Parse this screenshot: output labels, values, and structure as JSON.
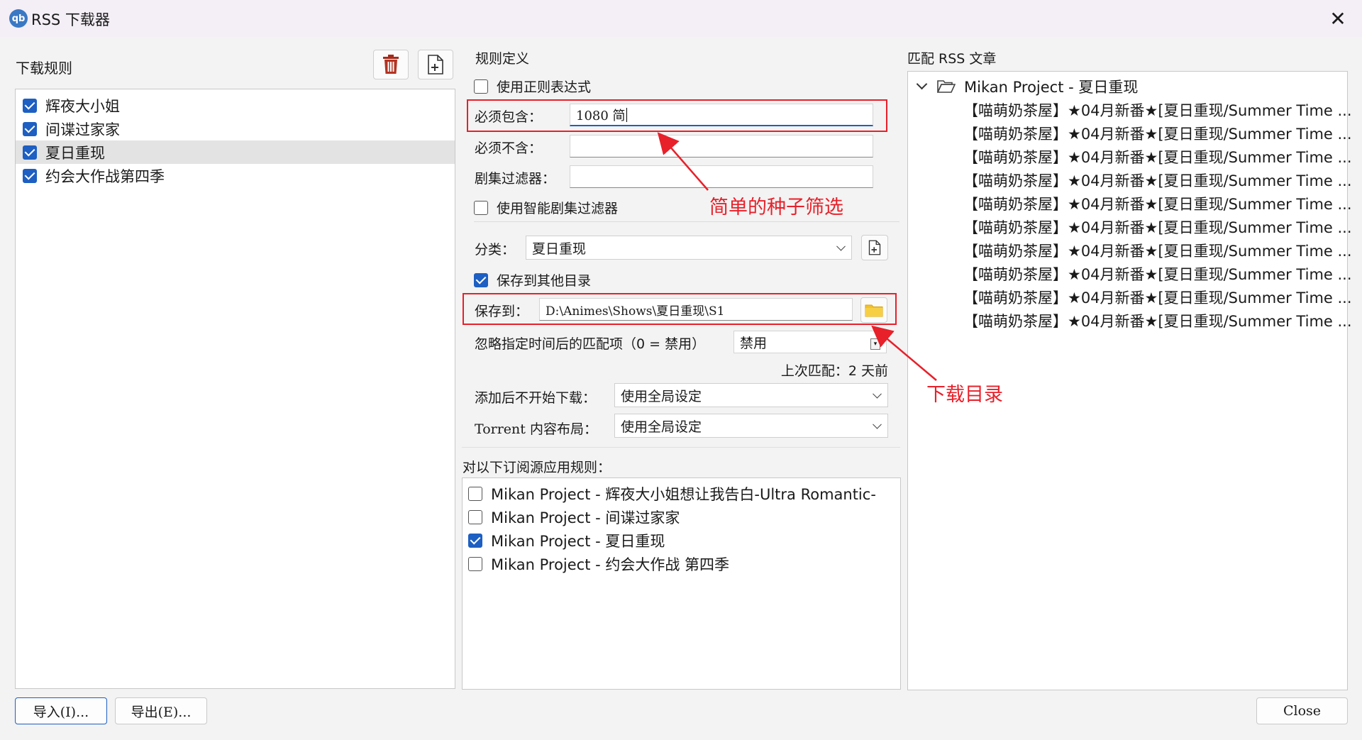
{
  "window": {
    "app_icon_text": "qb",
    "title": "RSS 下载器",
    "close_glyph": "✕"
  },
  "rules_panel": {
    "title": "下载规则",
    "rules": [
      {
        "label": "辉夜大小姐",
        "checked": true,
        "selected": false
      },
      {
        "label": "间谍过家家",
        "checked": true,
        "selected": false
      },
      {
        "label": "夏日重现",
        "checked": true,
        "selected": true
      },
      {
        "label": "约会大作战第四季",
        "checked": true,
        "selected": false
      }
    ],
    "delete_icon": "trash-icon",
    "add_icon": "add-file-icon"
  },
  "rule_def": {
    "title": "规则定义",
    "use_regex_label": "使用正则表达式",
    "must_contain_label": "必须包含：",
    "must_contain_value": "1080 简",
    "must_not_contain_label": "必须不含：",
    "must_not_contain_value": "",
    "episode_filter_label": "剧集过滤器：",
    "episode_filter_value": "",
    "smart_filter_label": "使用智能剧集过滤器",
    "category_label": "分类：",
    "category_value": "夏日重现",
    "save_other_label": "保存到其他目录",
    "save_to_label": "保存到：",
    "save_to_value": "D:\\Animes\\Shows\\夏日重现\\S1",
    "ignore_label": "忽略指定时间后的匹配项（0 = 禁用）",
    "ignore_value": "禁用",
    "last_match": "上次匹配：2 天前",
    "add_paused_label": "添加后不开始下载：",
    "add_paused_value": "使用全局设定",
    "layout_label": "Torrent 内容布局：",
    "layout_value": "使用全局设定"
  },
  "feeds": {
    "title": "对以下订阅源应用规则：",
    "items": [
      {
        "label": "Mikan Project - 辉夜大小姐想让我告白-Ultra Romantic-",
        "checked": false
      },
      {
        "label": "Mikan Project - 间谍过家家",
        "checked": false
      },
      {
        "label": "Mikan Project - 夏日重现",
        "checked": true
      },
      {
        "label": "Mikan Project - 约会大作战 第四季",
        "checked": false
      }
    ]
  },
  "matching": {
    "title": "匹配 RSS 文章",
    "group": "Mikan Project - 夏日重现",
    "articles": [
      "【喵萌奶茶屋】★04月新番★[夏日重现/Summer Time ...",
      "【喵萌奶茶屋】★04月新番★[夏日重现/Summer Time ...",
      "【喵萌奶茶屋】★04月新番★[夏日重现/Summer Time ...",
      "【喵萌奶茶屋】★04月新番★[夏日重现/Summer Time ...",
      "【喵萌奶茶屋】★04月新番★[夏日重现/Summer Time ...",
      "【喵萌奶茶屋】★04月新番★[夏日重现/Summer Time ...",
      "【喵萌奶茶屋】★04月新番★[夏日重现/Summer Time ...",
      "【喵萌奶茶屋】★04月新番★[夏日重现/Summer Time ...",
      "【喵萌奶茶屋】★04月新番★[夏日重现/Summer Time ...",
      "【喵萌奶茶屋】★04月新番★[夏日重现/Summer Time ..."
    ]
  },
  "buttons": {
    "import": "导入(I)...",
    "export": "导出(E)...",
    "close": "Close"
  },
  "annotations": {
    "filter": "简单的种子筛选",
    "download_dir": "下载目录"
  },
  "colors": {
    "accent": "#1d5fc2",
    "annotation": "#e8202a",
    "folder": "#f2c12e"
  }
}
